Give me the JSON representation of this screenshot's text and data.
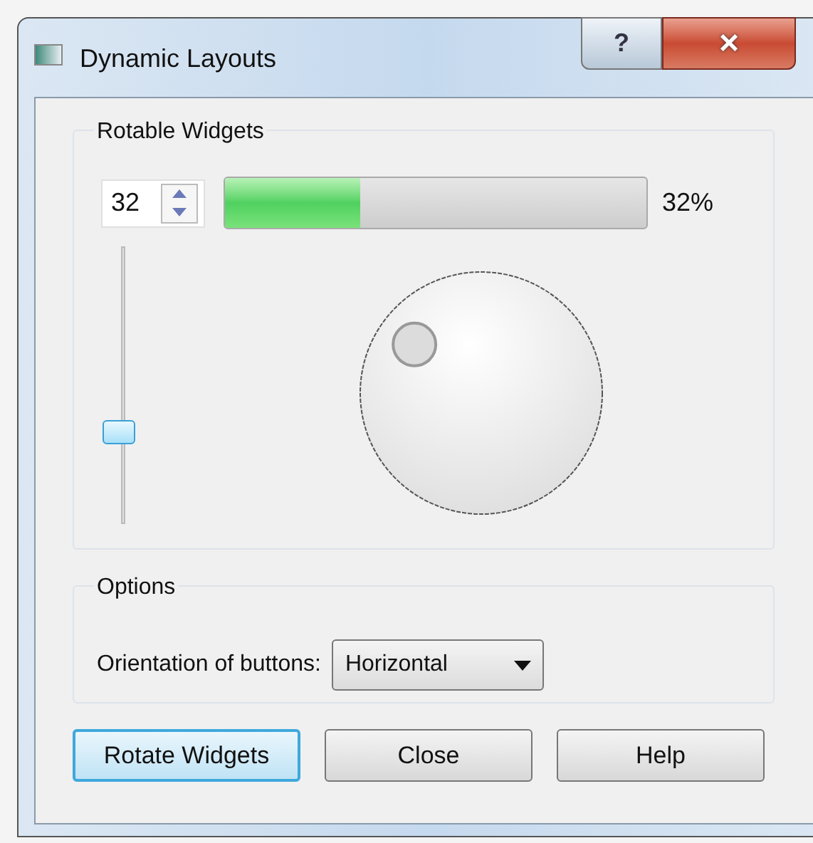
{
  "window": {
    "title": "Dynamic Layouts",
    "help_button": "?",
    "close_button": "×"
  },
  "rotable_group": {
    "title": "Rotable Widgets",
    "spinbox": {
      "value": "32"
    },
    "progress": {
      "level": 0.32,
      "reading": "32%"
    },
    "slider": {
      "level": 0.32
    },
    "dial": {
      "level": 0.32
    }
  },
  "options_group": {
    "title": "Options",
    "label": "Orientation of buttons:",
    "combo": {
      "value": "Horizontal"
    }
  },
  "buttons": [
    {
      "label": "Rotate Widgets",
      "default": true
    },
    {
      "label": "Close",
      "default": false
    },
    {
      "label": "Help",
      "default": false
    }
  ]
}
